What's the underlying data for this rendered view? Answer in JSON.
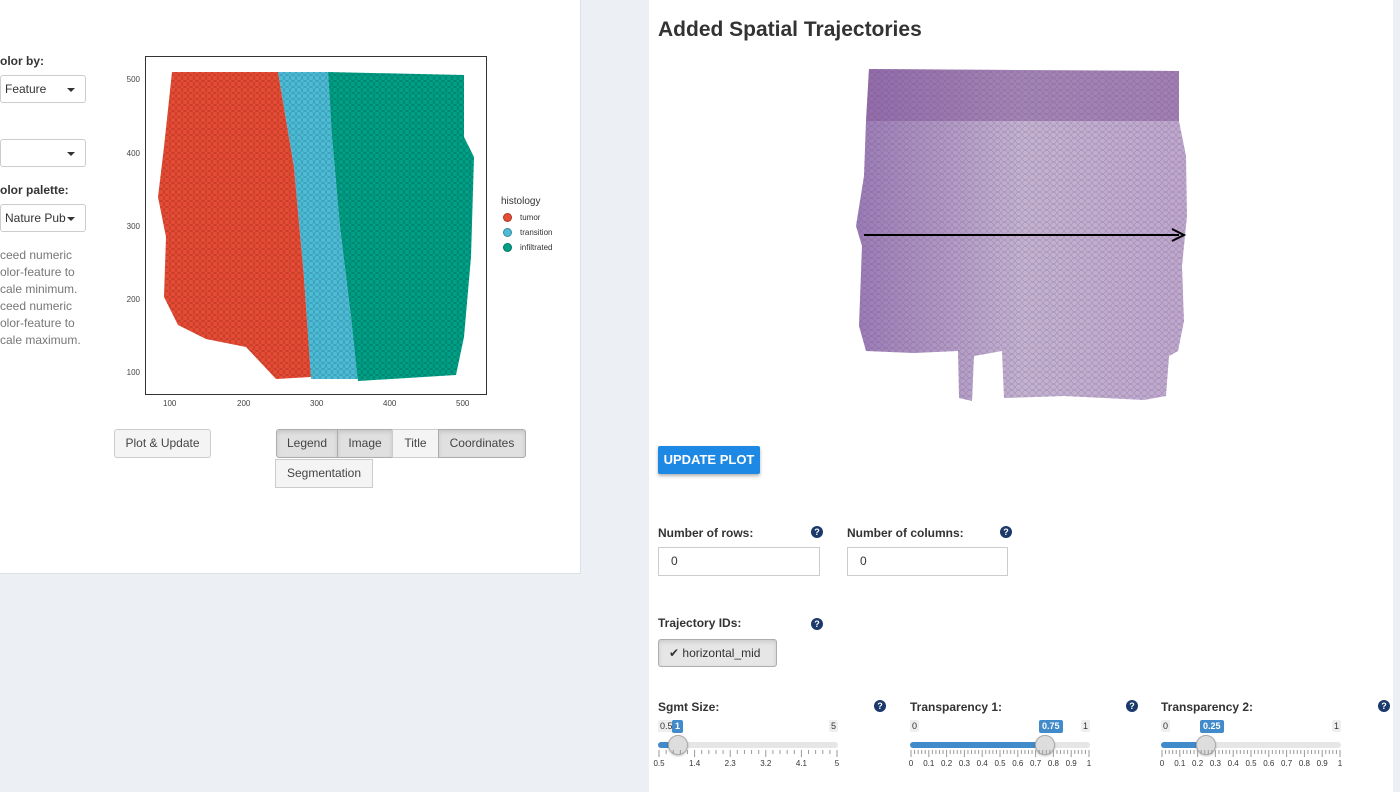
{
  "left": {
    "color_by_label": "olor by:",
    "color_by_value": "Feature",
    "select2_value": "",
    "palette_label": "olor palette:",
    "palette_value": "Nature Pub",
    "help_lines": [
      "ceed numeric",
      "olor-feature to",
      "cale minimum.",
      "ceed numeric",
      "olor-feature to",
      "cale maximum."
    ],
    "plot_update_label": "Plot & Update",
    "toggle_buttons": [
      "Legend",
      "Image",
      "Title",
      "Coordinates"
    ],
    "segmentation_label": "Segmentation",
    "plot": {
      "y_ticks": [
        "500",
        "400",
        "300",
        "200",
        "100"
      ],
      "x_ticks": [
        "100",
        "200",
        "300",
        "400",
        "500"
      ],
      "legend_title": "histology",
      "legend": [
        {
          "label": "tumor",
          "color": "#e64b35"
        },
        {
          "label": "transition",
          "color": "#4dbbd5"
        },
        {
          "label": "infiltrated",
          "color": "#00a087"
        }
      ]
    }
  },
  "right": {
    "title": "Added Spatial Trajectories",
    "update_label": "UPDATE PLOT",
    "rows_label": "Number of rows:",
    "rows_value": "0",
    "cols_label": "Number of columns:",
    "cols_value": "0",
    "traj_label": "Trajectory IDs:",
    "traj_value": "horizontal_mid",
    "sliders": [
      {
        "label": "Sgmt Size:",
        "min": "0.5",
        "max": "5",
        "value": "1",
        "fraction": 0.111,
        "tick_labels": [
          "0.5",
          "1.4",
          "2.3",
          "3.2",
          "4.1",
          "5"
        ]
      },
      {
        "label": "Transparency 1:",
        "min": "0",
        "max": "1",
        "value": "0.75",
        "fraction": 0.75,
        "tick_labels": [
          "0",
          "0.1",
          "0.2",
          "0.3",
          "0.4",
          "0.5",
          "0.6",
          "0.7",
          "0.8",
          "0.9",
          "1"
        ]
      },
      {
        "label": "Transparency 2:",
        "min": "0",
        "max": "1",
        "value": "0.25",
        "fraction": 0.25,
        "tick_labels": [
          "0",
          "0.1",
          "0.2",
          "0.3",
          "0.4",
          "0.5",
          "0.6",
          "0.7",
          "0.8",
          "0.9",
          "1"
        ]
      }
    ]
  },
  "colors": {
    "accent": "#1e88e5",
    "slider_blue": "#428bca",
    "help_icon": "#1b3a6b"
  }
}
